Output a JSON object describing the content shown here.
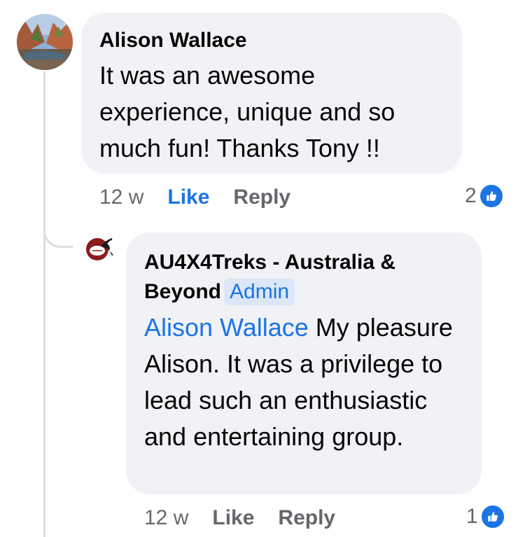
{
  "comment": {
    "author": "Alison Wallace",
    "text": "It was an awesome experience, unique and so much fun! Thanks Tony !!",
    "time": "12 w",
    "like_label": "Like",
    "reply_label": "Reply",
    "reaction_count": "2"
  },
  "reply": {
    "author": "AU4X4Treks - Australia & Beyond",
    "badge": "Admin",
    "mention": "Alison Wallace",
    "text": " My pleasure Alison. It was a privilege to lead such an enthusiastic and entertaining group.",
    "time": "12 w",
    "like_label": "Like",
    "reply_label": "Reply",
    "reaction_count": "1"
  },
  "colors": {
    "accent": "#1b74e4",
    "bubble": "#f0f2f5",
    "muted": "#65676b"
  },
  "icons": {
    "reaction": "thumbs-up-icon"
  }
}
